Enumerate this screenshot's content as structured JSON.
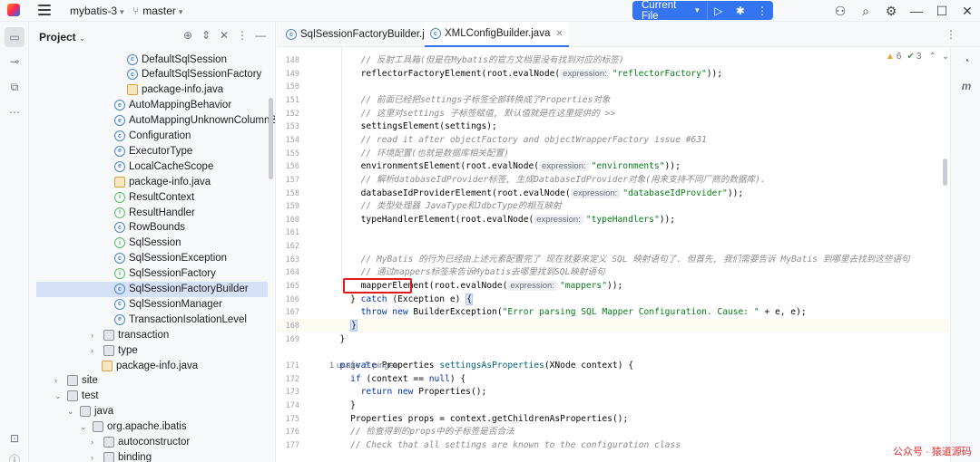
{
  "titlebar": {
    "project_name": "mybatis-3",
    "branch_name": "master",
    "run_config": "Current File"
  },
  "project_panel": {
    "title": "Project",
    "tree": [
      {
        "label": "DefaultSqlSession",
        "icon": "class",
        "indent": 108
      },
      {
        "label": "DefaultSqlSessionFactory",
        "icon": "class",
        "indent": 108
      },
      {
        "label": "package-info.java",
        "icon": "file",
        "indent": 108
      },
      {
        "label": "AutoMappingBehavior",
        "icon": "enum",
        "indent": 94
      },
      {
        "label": "AutoMappingUnknownColumnBehavior",
        "icon": "enum",
        "indent": 94
      },
      {
        "label": "Configuration",
        "icon": "class",
        "indent": 94
      },
      {
        "label": "ExecutorType",
        "icon": "enum",
        "indent": 94
      },
      {
        "label": "LocalCacheScope",
        "icon": "enum",
        "indent": 94
      },
      {
        "label": "package-info.java",
        "icon": "file",
        "indent": 94
      },
      {
        "label": "ResultContext",
        "icon": "interface",
        "indent": 94
      },
      {
        "label": "ResultHandler",
        "icon": "interface",
        "indent": 94
      },
      {
        "label": "RowBounds",
        "icon": "class",
        "indent": 94
      },
      {
        "label": "SqlSession",
        "icon": "interface",
        "indent": 94
      },
      {
        "label": "SqlSessionException",
        "icon": "class",
        "indent": 94
      },
      {
        "label": "SqlSessionFactory",
        "icon": "interface",
        "indent": 94
      },
      {
        "label": "SqlSessionFactoryBuilder",
        "icon": "class",
        "indent": 94,
        "selected": true
      },
      {
        "label": "SqlSessionManager",
        "icon": "class",
        "indent": 94
      },
      {
        "label": "TransactionIsolationLevel",
        "icon": "enum",
        "indent": 94
      },
      {
        "label": "transaction",
        "icon": "folder",
        "indent": 68,
        "chevron": "›"
      },
      {
        "label": "type",
        "icon": "folder",
        "indent": 68,
        "chevron": "›"
      },
      {
        "label": "package-info.java",
        "icon": "file",
        "indent": 80
      },
      {
        "label": "site",
        "icon": "folder",
        "indent": 28,
        "chevron": "›"
      },
      {
        "label": "test",
        "icon": "folder",
        "indent": 28,
        "chevron": "⌄"
      },
      {
        "label": "java",
        "icon": "folder",
        "indent": 42,
        "chevron": "⌄"
      },
      {
        "label": "org.apache.ibatis",
        "icon": "folder",
        "indent": 56,
        "chevron": "⌄"
      },
      {
        "label": "autoconstructor",
        "icon": "folder",
        "indent": 68,
        "chevron": "›"
      },
      {
        "label": "binding",
        "icon": "folder",
        "indent": 68,
        "chevron": "›"
      }
    ]
  },
  "tabs": [
    {
      "label": "SqlSessionFactoryBuilder.java",
      "active": false
    },
    {
      "label": "XMLConfigBuilder.java",
      "active": true
    }
  ],
  "inspections": {
    "warnings": "6",
    "weak_warnings": "3"
  },
  "editor": {
    "lines": [
      {
        "n": "148",
        "html": "      <span class=\"cmt\">// 反射工具箱(但是在Mybatis的官方文档里没有找到对应的标签)</span>"
      },
      {
        "n": "149",
        "html": "      reflectorFactoryElement(root.evalNode(<span class=\"hint\">expression:</span><span class=\"str\">\"reflectorFactory\"</span>));"
      },
      {
        "n": "150",
        "html": ""
      },
      {
        "n": "151",
        "html": "      <span class=\"cmt\">// 前面已经把settings子标签全部转换成了Properties对象</span>"
      },
      {
        "n": "152",
        "html": "      <span class=\"cmt\">// 这里对settings 子标签赋值, 默认值就是在这里提供的 &gt;&gt;</span>"
      },
      {
        "n": "153",
        "html": "      settingsElement(settings);"
      },
      {
        "n": "154",
        "html": "      <span class=\"cmt\">// read it after objectFactory and objectWrapperFactory issue #631</span>"
      },
      {
        "n": "155",
        "html": "      <span class=\"cmt\">// 环境配置(也就是数据库相关配置)</span>"
      },
      {
        "n": "156",
        "html": "      environmentsElement(root.evalNode(<span class=\"hint\">expression:</span><span class=\"str\">\"environments\"</span>));"
      },
      {
        "n": "157",
        "html": "      <span class=\"cmt\">// 解析databaseIdProvider标签, 生成DatabaseIdProvider对象(用来支持不同厂商的数据库).</span>"
      },
      {
        "n": "158",
        "html": "      databaseIdProviderElement(root.evalNode(<span class=\"hint\">expression:</span><span class=\"str\">\"databaseIdProvider\"</span>));"
      },
      {
        "n": "159",
        "html": "      <span class=\"cmt\">// 类型处理器 JavaType和JdbcType的相互映射</span>"
      },
      {
        "n": "160",
        "html": "      typeHandlerElement(root.evalNode(<span class=\"hint\">expression:</span><span class=\"str\">\"typeHandlers\"</span>));"
      },
      {
        "n": "161",
        "html": ""
      },
      {
        "n": "162",
        "html": ""
      },
      {
        "n": "163",
        "html": "      <span class=\"cmt\">// MyBatis 的行为已经由上述元素配置完了 现在就要来定义 SQL 映射语句了. 但首先, 我们需要告诉 MyBatis 到哪里去找到这些语句</span>"
      },
      {
        "n": "164",
        "html": "      <span class=\"cmt\">// 通过mappers标签来告诉Mybatis去哪里找到SQL映射语句</span>"
      },
      {
        "n": "165",
        "html": "      mapperElement(root.evalNode(<span class=\"hint\">expression:</span><span class=\"str\">\"mappers\"</span>));"
      },
      {
        "n": "166",
        "html": "    } <span class=\"kw\">catch</span> (Exception e) <span class=\"bracehl\">{</span>"
      },
      {
        "n": "167",
        "html": "      <span class=\"kw\">throw new</span> BuilderException(<span class=\"str\">\"Error parsing SQL Mapper Configuration. Cause: \"</span> + e, e);"
      },
      {
        "n": "168",
        "html": "    <span class=\"bracehl\">}</span>"
      },
      {
        "n": "169",
        "html": "  }"
      },
      {
        "n": "",
        "html": ""
      },
      {
        "n": "171",
        "html": "  <span class=\"kw\">private</span> Properties <span class=\"fn\">settingsAsProperties</span>(XNode context) {"
      },
      {
        "n": "172",
        "html": "    <span class=\"kw\">if</span> (context == <span class=\"kw\">null</span>) {"
      },
      {
        "n": "173",
        "html": "      <span class=\"kw\">return new</span> Properties();"
      },
      {
        "n": "174",
        "html": "    }"
      },
      {
        "n": "175",
        "html": "    Properties props = context.getChildrenAsProperties();"
      },
      {
        "n": "176",
        "html": "    <span class=\"cmt\">// 检查得到的props中的子标签是否合法</span>"
      },
      {
        "n": "177",
        "html": "    <span class=\"cmt\">// Check that all settings are known to the configuration class</span>"
      }
    ],
    "usage_hint": "1 usage   ♙ pingee"
  },
  "watermark": "公众号 · 猿道源码"
}
